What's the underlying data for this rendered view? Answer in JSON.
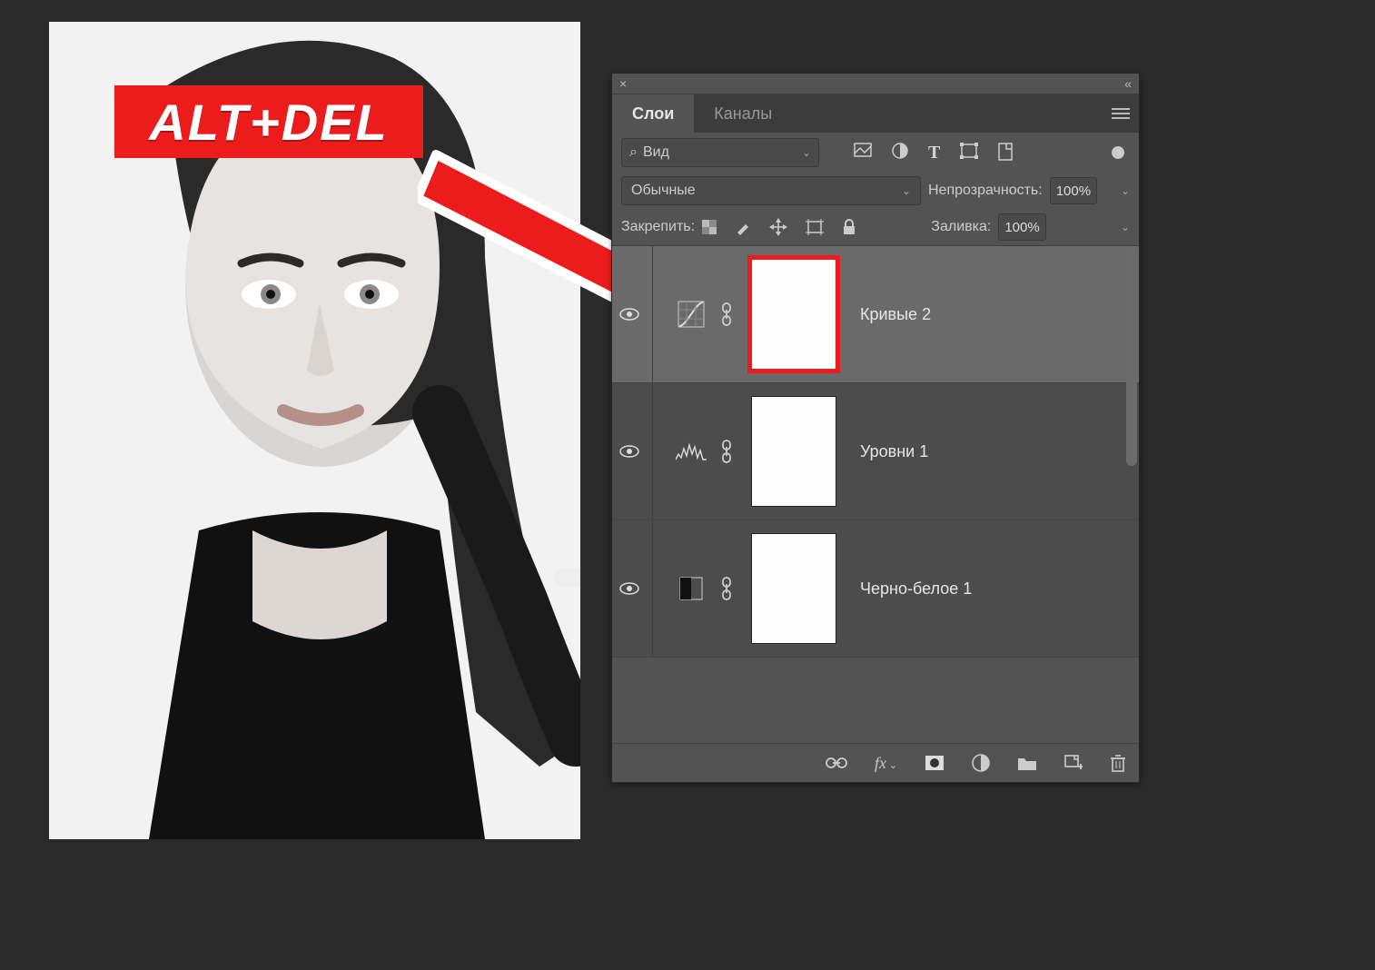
{
  "badge": {
    "text": "ALT+DEL"
  },
  "panel": {
    "tabs": {
      "layers": "Слои",
      "channels": "Каналы"
    },
    "search": {
      "placeholder": "Вид"
    },
    "blend_mode": "Обычные",
    "opacity_label": "Непрозрачность:",
    "opacity_value": "100%",
    "fill_label": "Заливка:",
    "fill_value": "100%"
  },
  "layers": [
    {
      "name": "Кривые 2",
      "type": "curves",
      "selected": true,
      "mask_highlight": true
    },
    {
      "name": "Уровни 1",
      "type": "levels",
      "selected": false,
      "mask_highlight": false
    },
    {
      "name": "Черно-белое 1",
      "type": "bw",
      "selected": false,
      "mask_highlight": false
    }
  ],
  "footer_icons": [
    "link",
    "fx",
    "mask",
    "adjust",
    "group",
    "new",
    "trash"
  ]
}
